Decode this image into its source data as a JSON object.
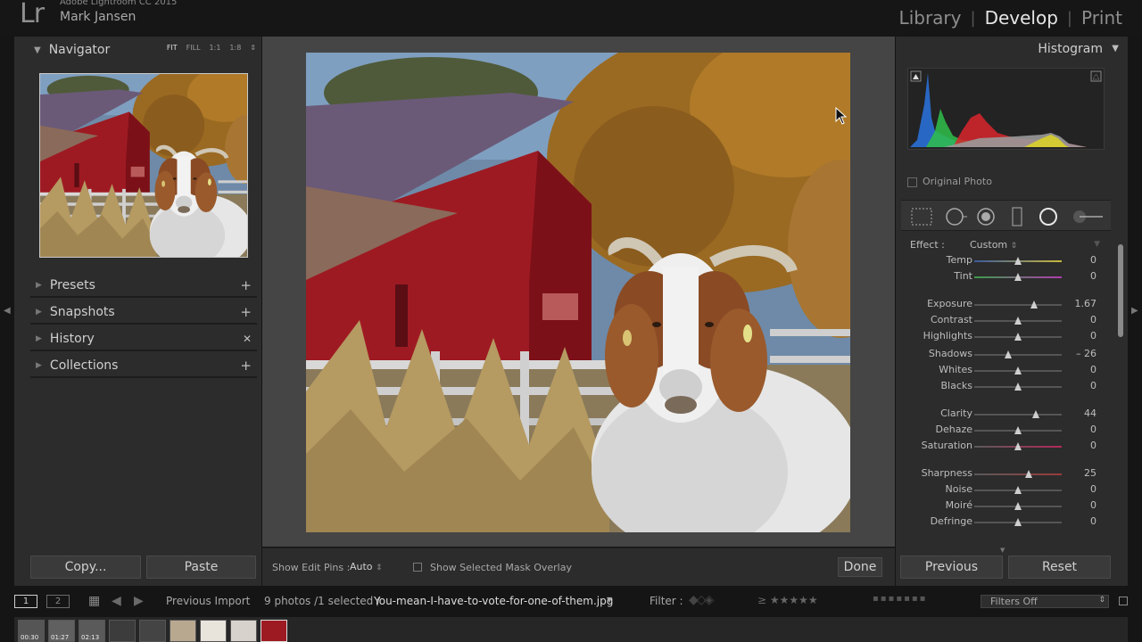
{
  "app": {
    "logo": "Lr",
    "name": "Adobe Lightroom CC 2015",
    "user": "Mark Jansen"
  },
  "modules": [
    {
      "label": "Library",
      "active": false
    },
    {
      "label": "Develop",
      "active": true
    },
    {
      "label": "Print",
      "active": false
    }
  ],
  "navigator": {
    "title": "Navigator",
    "zoom": [
      "FIT",
      "FILL",
      "1:1",
      "1:8"
    ],
    "zoom_selected": "FIT"
  },
  "left_sections": [
    {
      "label": "Presets",
      "action": "+"
    },
    {
      "label": "Snapshots",
      "action": "+"
    },
    {
      "label": "History",
      "action": "✕"
    },
    {
      "label": "Collections",
      "action": "+"
    }
  ],
  "buttons": {
    "copy": "Copy...",
    "paste": "Paste",
    "previous": "Previous",
    "reset": "Reset",
    "done": "Done"
  },
  "toolbar": {
    "pins_label": "Show Edit Pins :",
    "pins_value": "Auto",
    "mask_label": "Show Selected Mask Overlay"
  },
  "histogram": {
    "title": "Histogram",
    "original_photo": "Original Photo"
  },
  "effect": {
    "label": "Effect :",
    "value": "Custom"
  },
  "adjustments": [
    {
      "name": "Temp",
      "value": "0",
      "level": 0.5
    },
    {
      "name": "Tint",
      "value": "0",
      "level": 0.5
    },
    {
      "name": "Exposure",
      "value": "1.67",
      "level": 0.68
    },
    {
      "name": "Contrast",
      "value": "0",
      "level": 0.5
    },
    {
      "name": "Highlights",
      "value": "0",
      "level": 0.5
    },
    {
      "name": "Shadows",
      "value": "– 26",
      "level": 0.39
    },
    {
      "name": "Whites",
      "value": "0",
      "level": 0.5
    },
    {
      "name": "Blacks",
      "value": "0",
      "level": 0.5
    },
    {
      "name": "Clarity",
      "value": "44",
      "level": 0.7
    },
    {
      "name": "Dehaze",
      "value": "0",
      "level": 0.5
    },
    {
      "name": "Saturation",
      "value": "0",
      "level": 0.5
    },
    {
      "name": "Sharpness",
      "value": "25",
      "level": 0.62
    },
    {
      "name": "Noise",
      "value": "0",
      "level": 0.5
    },
    {
      "name": "Moiré",
      "value": "0",
      "level": 0.5
    },
    {
      "name": "Defringe",
      "value": "0",
      "level": 0.5
    }
  ],
  "filmstrip": {
    "monitors": [
      "1",
      "2"
    ],
    "source": "Previous Import",
    "count": "9 photos /1 selected /",
    "file": "You-mean-I-have-to-vote-for-one-of-them.jpg",
    "filter_label": "Filter :",
    "filters_value": "Filters Off",
    "thumb_labels": [
      "00:30",
      "01:27",
      "02:13"
    ]
  },
  "colors": {
    "barn_red": "#9e1a22",
    "roof": "#6a5a78",
    "panel": "#2c2c2c",
    "canvas": "#454545"
  }
}
